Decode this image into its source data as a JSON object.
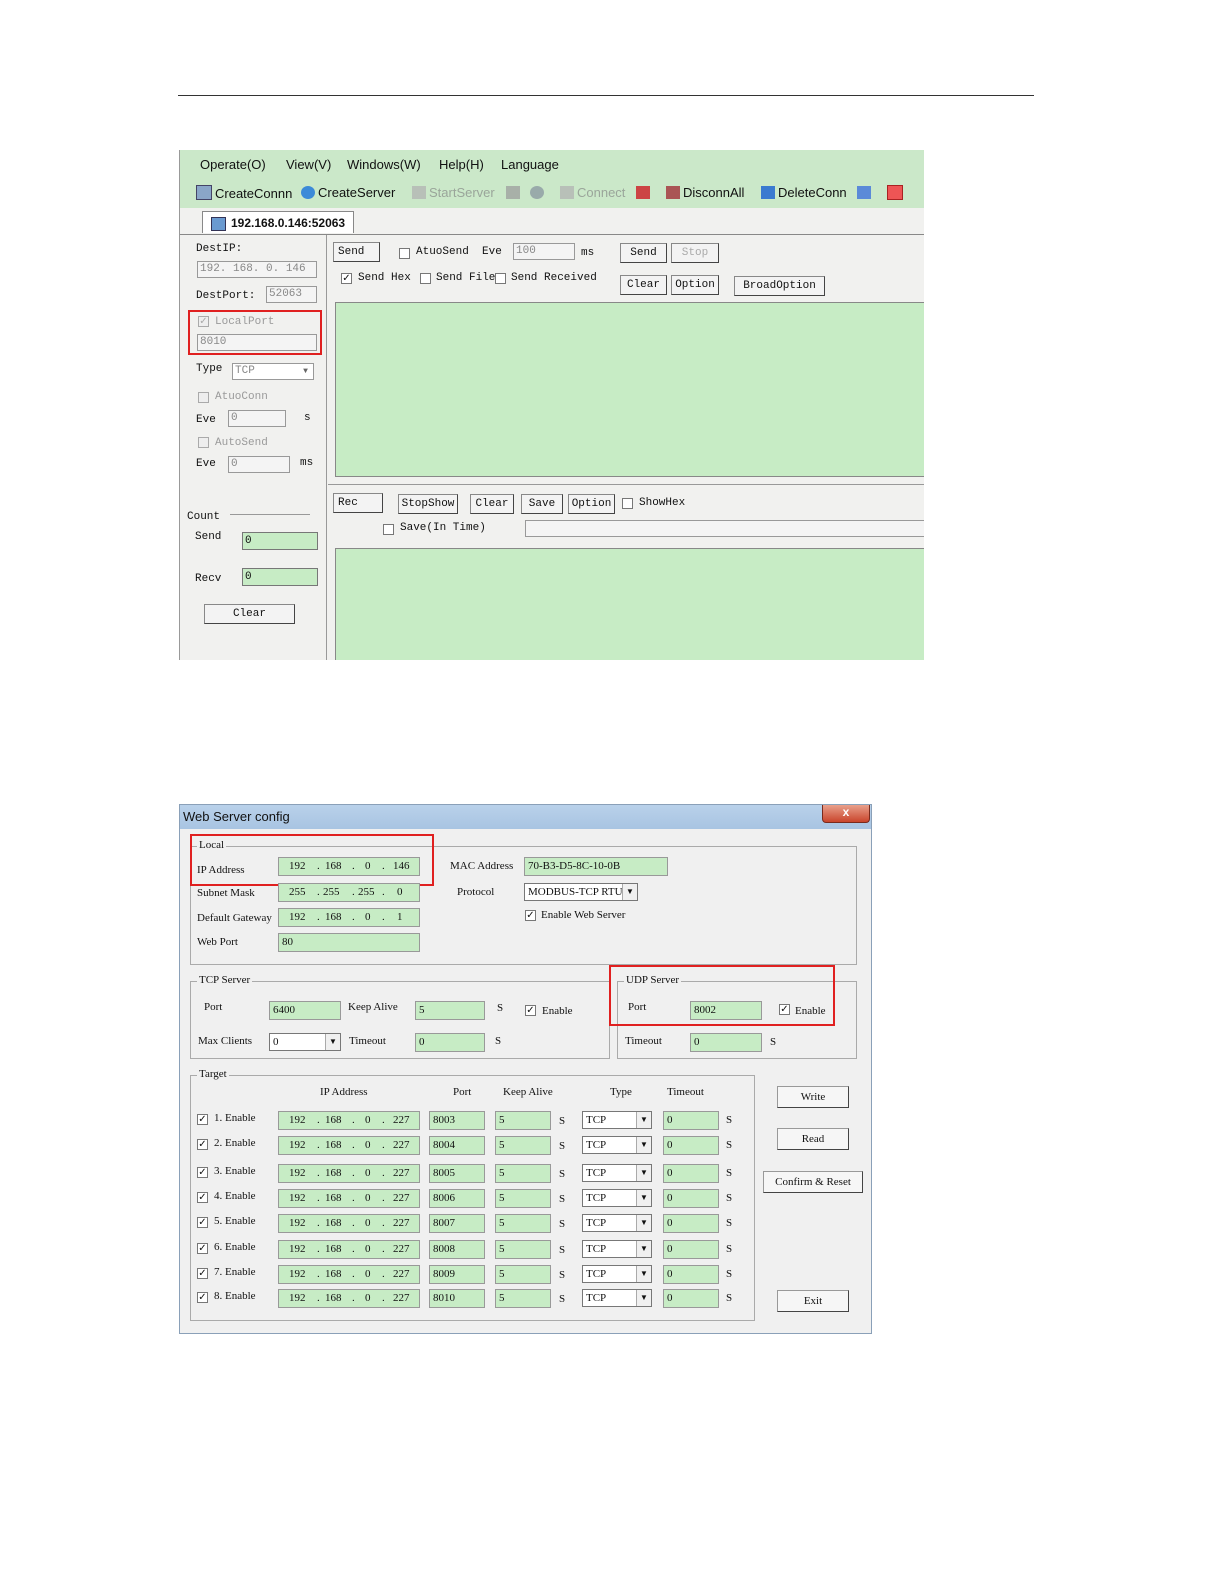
{
  "app": {
    "menu": [
      "Operate(O)",
      "View(V)",
      "Windows(W)",
      "Help(H)",
      "Language"
    ],
    "toolbar": [
      {
        "label": "CreateConnn",
        "icon": "create-connection-icon",
        "enabled": true
      },
      {
        "label": "CreateServer",
        "icon": "create-server-icon",
        "enabled": true
      },
      {
        "label": "StartServer",
        "icon": "start-server-icon",
        "enabled": false
      },
      {
        "label": "Connect",
        "icon": "connect-icon",
        "enabled": false
      },
      {
        "label": "DisconnAll",
        "icon": "disconnect-all-icon",
        "enabled": true
      },
      {
        "label": "DeleteConn",
        "icon": "delete-connection-icon",
        "enabled": true
      }
    ],
    "tab": "192.168.0.146:52063",
    "left": {
      "dest_ip_label": "DestIP:",
      "dest_ip": "192. 168. 0. 146",
      "dest_port_label": "DestPort:",
      "dest_port": "52063",
      "local_port_label": "LocalPort",
      "local_port": "8010",
      "type_label": "Type",
      "type_value": "TCP",
      "atuo_conn_label": "AtuoConn",
      "eve_label": "Eve",
      "eve1": "0",
      "eve1_unit": "s",
      "auto_send_label": "AutoSend",
      "eve2": "0",
      "eve2_unit": "ms",
      "count_label": "Count",
      "send_label": "Send",
      "send_count": "0",
      "recv_label": "Recv",
      "recv_count": "0",
      "clear_button": "Clear"
    },
    "send_panel": {
      "send_tag": "Send",
      "atuo_send_label": "AtuoSend",
      "eve_label": "Eve",
      "eve_value": "100",
      "eve_unit": "ms",
      "send_button": "Send",
      "stop_button": "Stop",
      "send_hex_label": "Send Hex",
      "send_file_label": "Send File",
      "send_received_label": "Send Received",
      "clear_button": "Clear",
      "option_button": "Option",
      "broad_option_button": "BroadOption"
    },
    "rec_panel": {
      "rec_tag": "Rec",
      "stop_show_button": "StopShow",
      "clear_button": "Clear",
      "save_button": "Save",
      "option_button": "Option",
      "show_hex_label": "ShowHex",
      "save_in_time_label": "Save(In Time)"
    }
  },
  "config": {
    "title": "Web Server config",
    "close": "x",
    "local": {
      "label": "Local",
      "ip_label": "IP Address",
      "ip": [
        "192",
        "168",
        "0",
        "146"
      ],
      "subnet_label": "Subnet Mask",
      "subnet": [
        "255",
        "255",
        "255",
        "0"
      ],
      "gateway_label": "Default Gateway",
      "gateway": [
        "192",
        "168",
        "0",
        "1"
      ],
      "web_port_label": "Web Port",
      "web_port": "80",
      "mac_label": "MAC Address",
      "mac": "70-B3-D5-8C-10-0B",
      "protocol_label": "Protocol",
      "protocol": "MODBUS-TCP RTU",
      "enable_web_label": "Enable Web Server"
    },
    "tcp": {
      "label": "TCP Server",
      "port_label": "Port",
      "port": "6400",
      "keep_alive_label": "Keep Alive",
      "keep_alive": "5",
      "unit": "S",
      "enable_label": "Enable",
      "max_clients_label": "Max Clients",
      "max_clients": "0",
      "timeout_label": "Timeout",
      "timeout": "0"
    },
    "udp": {
      "label": "UDP Server",
      "port_label": "Port",
      "port": "8002",
      "enable_label": "Enable",
      "timeout_label": "Timeout",
      "timeout": "0",
      "unit": "S"
    },
    "target": {
      "label": "Target",
      "headers": [
        "IP Address",
        "Port",
        "Keep Alive",
        "Type",
        "Timeout"
      ],
      "rows": [
        {
          "enable": "1. Enable",
          "ip": [
            "192",
            "168",
            "0",
            "227"
          ],
          "port": "8003",
          "keep": "5",
          "unit1": "S",
          "type": "TCP",
          "timeout": "0",
          "unit2": "S"
        },
        {
          "enable": "2. Enable",
          "ip": [
            "192",
            "168",
            "0",
            "227"
          ],
          "port": "8004",
          "keep": "5",
          "unit1": "S",
          "type": "TCP",
          "timeout": "0",
          "unit2": "S"
        },
        {
          "enable": "3. Enable",
          "ip": [
            "192",
            "168",
            "0",
            "227"
          ],
          "port": "8005",
          "keep": "5",
          "unit1": "S",
          "type": "TCP",
          "timeout": "0",
          "unit2": "S"
        },
        {
          "enable": "4. Enable",
          "ip": [
            "192",
            "168",
            "0",
            "227"
          ],
          "port": "8006",
          "keep": "5",
          "unit1": "S",
          "type": "TCP",
          "timeout": "0",
          "unit2": "S"
        },
        {
          "enable": "5. Enable",
          "ip": [
            "192",
            "168",
            "0",
            "227"
          ],
          "port": "8007",
          "keep": "5",
          "unit1": "S",
          "type": "TCP",
          "timeout": "0",
          "unit2": "S"
        },
        {
          "enable": "6. Enable",
          "ip": [
            "192",
            "168",
            "0",
            "227"
          ],
          "port": "8008",
          "keep": "5",
          "unit1": "S",
          "type": "TCP",
          "timeout": "0",
          "unit2": "S"
        },
        {
          "enable": "7. Enable",
          "ip": [
            "192",
            "168",
            "0",
            "227"
          ],
          "port": "8009",
          "keep": "5",
          "unit1": "S",
          "type": "TCP",
          "timeout": "0",
          "unit2": "S"
        },
        {
          "enable": "8. Enable",
          "ip": [
            "192",
            "168",
            "0",
            "227"
          ],
          "port": "8010",
          "keep": "5",
          "unit1": "S",
          "type": "TCP",
          "timeout": "0",
          "unit2": "S"
        }
      ]
    },
    "buttons": {
      "write": "Write",
      "read": "Read",
      "confirm_reset": "Confirm & Reset",
      "exit": "Exit"
    },
    "checkmark": "✓",
    "dot": "."
  },
  "colors": {
    "field_green": "#c7ecc5",
    "highlight_red": "#e02020",
    "menubar_green": "#cbe8c9"
  }
}
